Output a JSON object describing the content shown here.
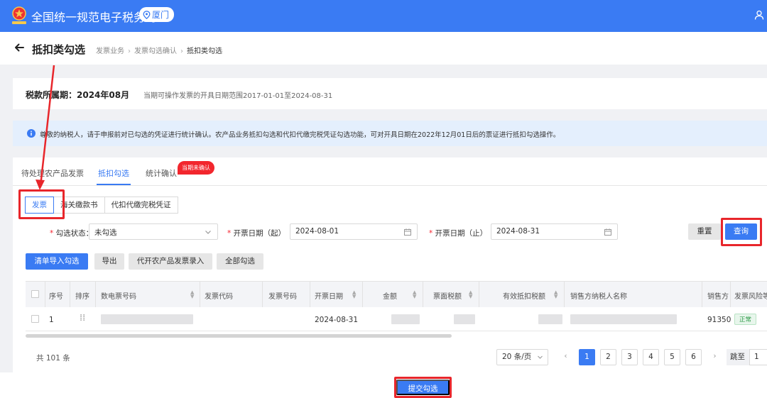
{
  "topbar": {
    "title": "全国统一规范电子税务局",
    "city": "厦门",
    "accent_color": "#3a7bf3",
    "icons": [
      "tax-emblem-icon",
      "location-pin-icon",
      "user-icon"
    ]
  },
  "header": {
    "page_title": "抵扣类勾选",
    "breadcrumbs": [
      "发票业务",
      "发票勾选确认",
      "抵扣类勾选"
    ]
  },
  "period": {
    "label": "税款所属期：2024年08月",
    "note": "当期可操作发票的开具日期范围2017-01-01至2024-08-31"
  },
  "notice": {
    "text": "尊敬的纳税人，请于申报前对已勾选的凭证进行统计确认。农产品业务抵扣勾选和代扣代缴完税凭证勾选功能，可对开具日期在2022年12月01日后的票证进行抵扣勾选操作。"
  },
  "tabs": [
    {
      "label": "待处理农产品发票",
      "active": false
    },
    {
      "label": "抵扣勾选",
      "active": true
    },
    {
      "label": "统计确认",
      "active": false
    }
  ],
  "badge": "当期未确认",
  "subtabs": [
    {
      "label": "发票",
      "active": true
    },
    {
      "label": "海关缴款书",
      "active": false
    },
    {
      "label": "代扣代缴完税凭证",
      "active": false
    }
  ],
  "filters": {
    "status_label": "勾选状态",
    "status_value": "未勾选",
    "start_label": "开票日期（起）",
    "start_value": "2024-08-01",
    "end_label": "开票日期（止）",
    "end_value": "2024-08-31",
    "reset": "重置",
    "query": "查询"
  },
  "actions": [
    "清单导入勾选",
    "导出",
    "代开农产品发票录入",
    "全部勾选"
  ],
  "table": {
    "headers": [
      "序号",
      "排序",
      "数电票号码",
      "发票代码",
      "发票号码",
      "开票日期",
      "金额",
      "票面税额",
      "有效抵扣税额",
      "销售方纳税人名称",
      "销售方",
      "发票风险等"
    ],
    "rows": [
      {
        "index": "1",
        "date": "2024-08-31",
        "seller_tax_id_partial": "91350",
        "risk": "正常"
      }
    ]
  },
  "pagination": {
    "total": "共 101 条",
    "page_size": "20 条/页",
    "pages": [
      "1",
      "2",
      "3",
      "4",
      "5",
      "6"
    ],
    "current": "1",
    "jump_label": "跳至",
    "jump_value": "1"
  },
  "submit": "提交勾选",
  "annotation_color": "#e8262b"
}
